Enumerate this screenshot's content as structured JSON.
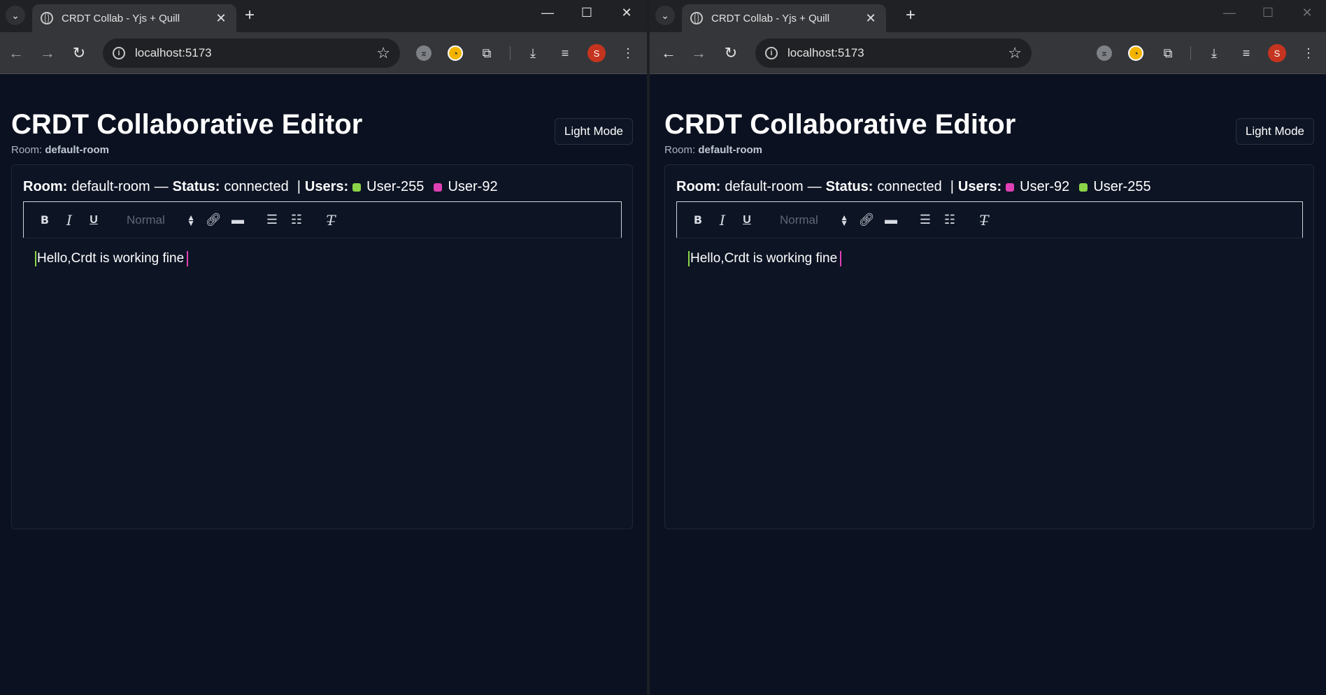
{
  "windows": [
    {
      "tab_title": "CRDT Collab - Yjs + Quill",
      "url": "localhost:5173",
      "avatar_letter": "S",
      "app_title": "CRDT Collaborative Editor",
      "room_label": "Room:",
      "room_name": "default-room",
      "mode_button": "Light Mode",
      "status": {
        "room_label": "Room:",
        "room_value": "default-room",
        "dash": "—",
        "status_label": "Status:",
        "status_value": "connected",
        "pipe": "|",
        "users_label": "Users:",
        "users": [
          {
            "name": "User-255",
            "color": "#8bd448"
          },
          {
            "name": "User-92",
            "color": "#e040b5"
          }
        ]
      },
      "toolbar": {
        "header_select": "Normal"
      },
      "document_text": "Hello,Crdt is working fine",
      "caret_colors": {
        "start": "#8bd448",
        "end": "#e040b5"
      }
    },
    {
      "tab_title": "CRDT Collab - Yjs + Quill",
      "url": "localhost:5173",
      "avatar_letter": "S",
      "app_title": "CRDT Collaborative Editor",
      "room_label": "Room:",
      "room_name": "default-room",
      "mode_button": "Light Mode",
      "status": {
        "room_label": "Room:",
        "room_value": "default-room",
        "dash": "—",
        "status_label": "Status:",
        "status_value": "connected",
        "pipe": "|",
        "users_label": "Users:",
        "users": [
          {
            "name": "User-92",
            "color": "#e040b5"
          },
          {
            "name": "User-255",
            "color": "#8bd448"
          }
        ]
      },
      "toolbar": {
        "header_select": "Normal"
      },
      "document_text": "Hello,Crdt is working fine",
      "caret_colors": {
        "start": "#8bd448",
        "end": "#e040b5"
      }
    }
  ]
}
